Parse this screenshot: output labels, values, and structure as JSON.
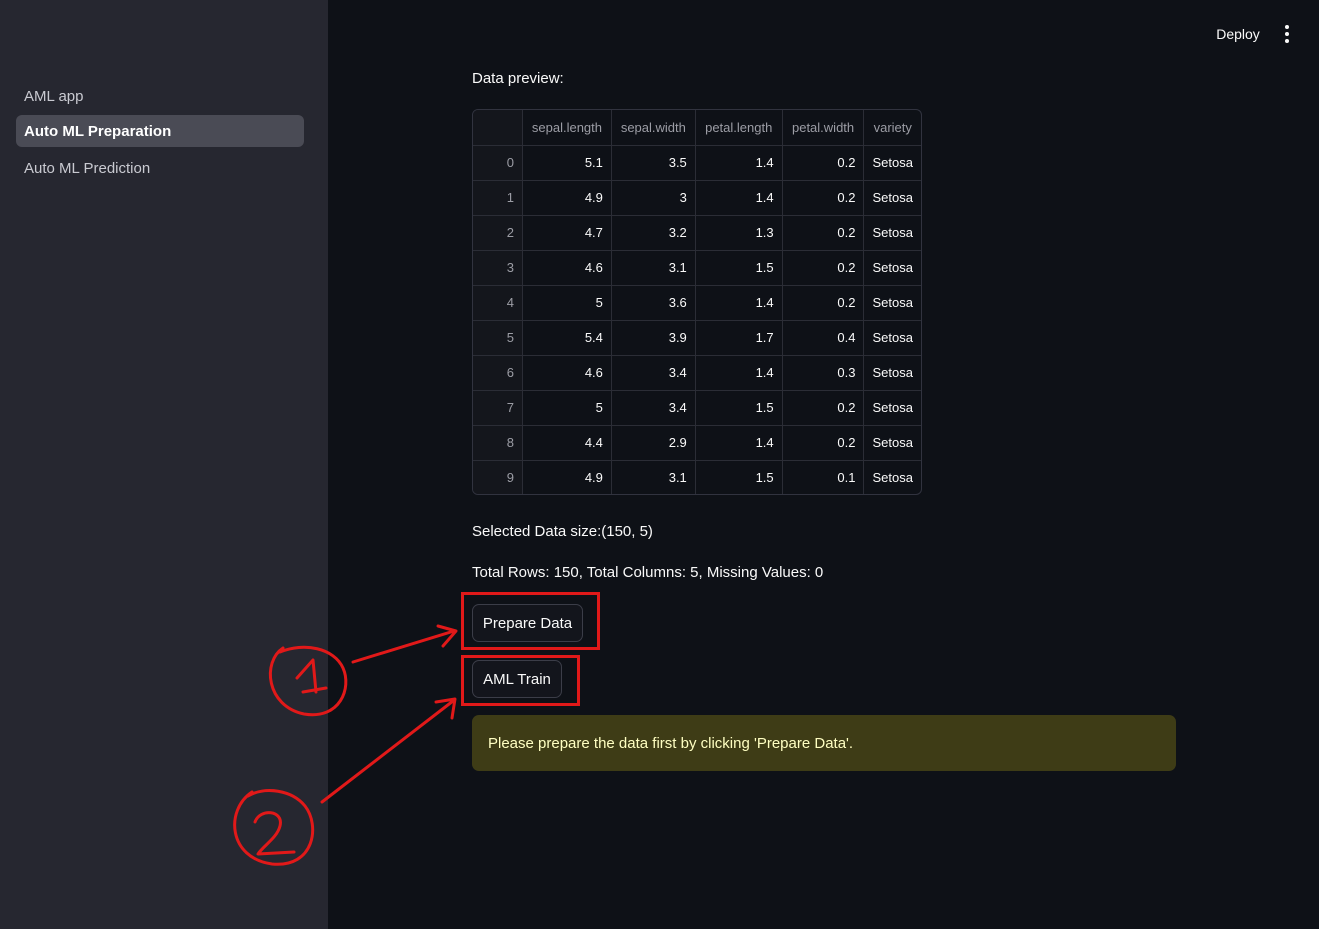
{
  "sidebar": {
    "items": [
      {
        "label": "AML app",
        "active": false
      },
      {
        "label": "Auto ML Preparation",
        "active": true
      },
      {
        "label": "Auto ML Prediction",
        "active": false
      }
    ]
  },
  "header": {
    "deploy_label": "Deploy",
    "menu_icon": "kebab-menu-icon"
  },
  "main": {
    "preview_label": "Data preview:",
    "table": {
      "columns": [
        "",
        "sepal.length",
        "sepal.width",
        "petal.length",
        "petal.width",
        "variety"
      ],
      "rows": [
        [
          "0",
          "5.1",
          "3.5",
          "1.4",
          "0.2",
          "Setosa"
        ],
        [
          "1",
          "4.9",
          "3",
          "1.4",
          "0.2",
          "Setosa"
        ],
        [
          "2",
          "4.7",
          "3.2",
          "1.3",
          "0.2",
          "Setosa"
        ],
        [
          "3",
          "4.6",
          "3.1",
          "1.5",
          "0.2",
          "Setosa"
        ],
        [
          "4",
          "5",
          "3.6",
          "1.4",
          "0.2",
          "Setosa"
        ],
        [
          "5",
          "5.4",
          "3.9",
          "1.7",
          "0.4",
          "Setosa"
        ],
        [
          "6",
          "4.6",
          "3.4",
          "1.4",
          "0.3",
          "Setosa"
        ],
        [
          "7",
          "5",
          "3.4",
          "1.5",
          "0.2",
          "Setosa"
        ],
        [
          "8",
          "4.4",
          "2.9",
          "1.4",
          "0.2",
          "Setosa"
        ],
        [
          "9",
          "4.9",
          "3.1",
          "1.5",
          "0.1",
          "Setosa"
        ]
      ]
    },
    "data_size_text": "Selected Data size:(150, 5)",
    "summary_text": "Total Rows: 150, Total Columns: 5, Missing Values: 0",
    "prepare_button": "Prepare Data",
    "train_button": "AML Train",
    "warning_text": "Please prepare the data first by clicking 'Prepare Data'."
  },
  "annotations": {
    "color": "#e11919",
    "marks": [
      "1",
      "2"
    ]
  }
}
